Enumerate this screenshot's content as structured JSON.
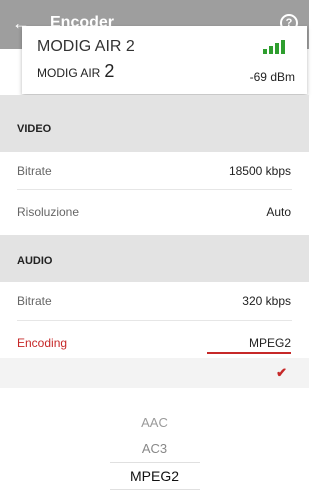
{
  "appbar": {
    "back_icon": "arrow-left-icon",
    "title": "Encoder",
    "help_label": "?",
    "help_icon": "help-circle-icon",
    "bg_color": "#9e9e9e"
  },
  "device": {
    "ghost_name": "MODIG AIR 2",
    "name": "MODIG AIR",
    "number": "2",
    "signal_icon": "signal-bars-icon",
    "signal_color": "#2e9e2e",
    "signal_dbm": "-69 dBm"
  },
  "video": {
    "title": "VIDEO",
    "bitrate_label": "Bitrate",
    "bitrate_value": "18500 kbps",
    "resolution_label": "Risoluzione",
    "resolution_value": "Auto"
  },
  "audio": {
    "title": "AUDIO",
    "bitrate_label": "Bitrate",
    "bitrate_value": "320 kbps",
    "encoding_label": "Encoding",
    "encoding_value": "MPEG2"
  },
  "check_icon": "checkmark-icon",
  "accent_color": "#c62828",
  "picker": {
    "options": [
      "AAC",
      "AC3",
      "MPEG2"
    ],
    "selected": "MPEG2"
  }
}
